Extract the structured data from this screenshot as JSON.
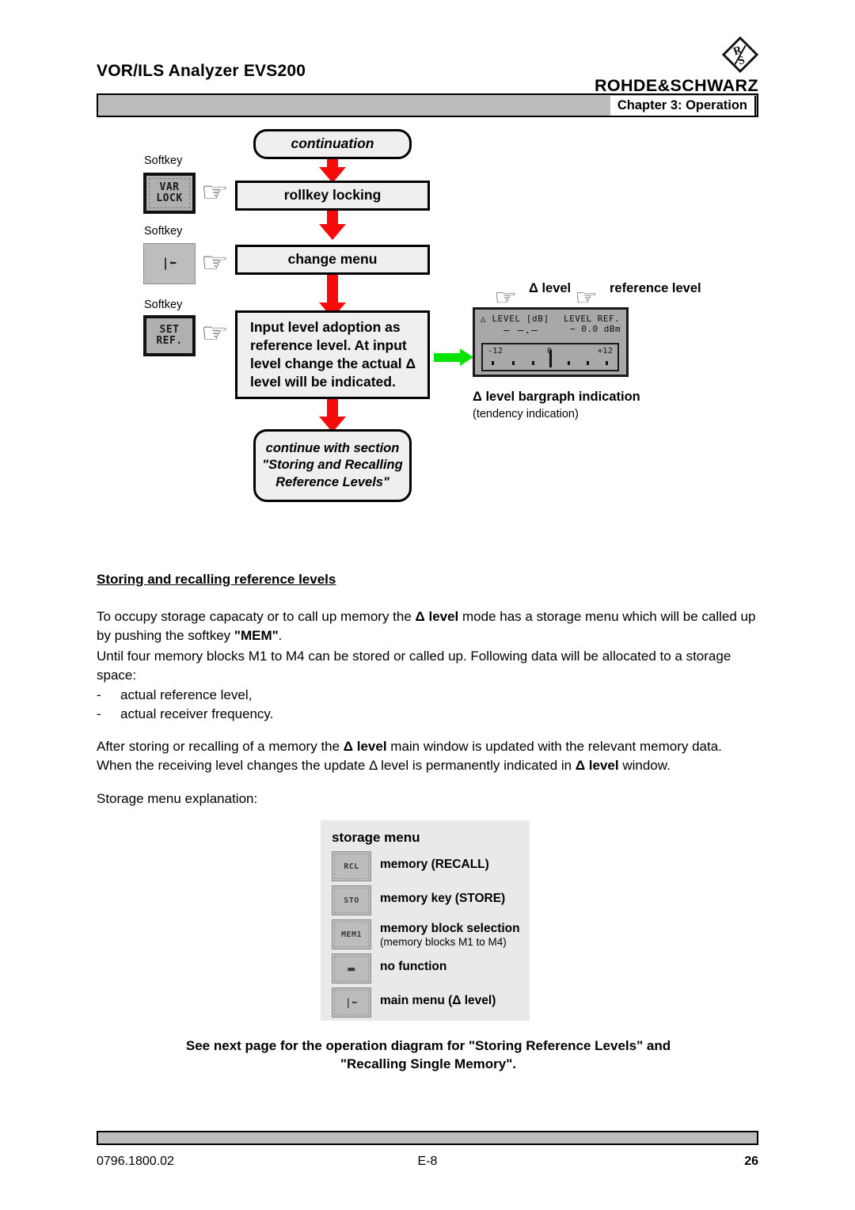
{
  "header": {
    "doc_title": "VOR/ILS Analyzer EVS200",
    "brand": "ROHDE&SCHWARZ",
    "chapter": "Chapter 3: Operation"
  },
  "flow": {
    "continuation_label": "continuation",
    "softkey_caption": "Softkey",
    "steps": [
      {
        "key_glyph": "VAR\nLOCK",
        "box_text": "rollkey locking"
      },
      {
        "key_glyph": "|⬅",
        "box_text": "change menu"
      },
      {
        "key_glyph": "SET\nREF.",
        "box_text": "Input level adoption as reference level. At input level change the actual Δ  level will be indicated."
      }
    ],
    "end_box": "continue with section \"Storing and Recalling Reference Levels\""
  },
  "lcd": {
    "callout_delta": "Δ  level",
    "callout_ref": "reference level",
    "screen": {
      "title": "△ LEVEL [dB]",
      "ref_title": "LEVEL REF.",
      "ref_value": "− 0.0 dBm",
      "value_placeholder": "— —.—",
      "bar_min": "-12",
      "bar_mid": "0",
      "bar_max": "+12"
    },
    "caption_main": "Δ  level bargraph indication",
    "caption_sub": "(tendency indication)"
  },
  "content": {
    "section_heading": "Storing and recalling reference levels",
    "para1_a": "To occupy storage capacaty or to call up memory the ",
    "para1_delta": "Δ level",
    "para1_b": " mode has a storage menu which will be called up by pushing the softkey ",
    "para1_mem": "\"MEM\"",
    "para1_c": ".",
    "para2": "Until four memory blocks M1 to M4 can be stored or called up. Following data will be allocated to a storage space:",
    "bullets": [
      {
        "dash": "-",
        "text": "actual reference level,"
      },
      {
        "dash": "-",
        "text": "actual receiver frequency."
      }
    ],
    "para3_a": "After storing or recalling of a memory the ",
    "para3_delta1": "Δ level",
    "para3_b": " main window is updated with the relevant memory data. When the receiving level changes the update Δ level is permanently indicated in ",
    "para3_delta2": "Δ level",
    "para3_c": " window.",
    "para4": "Storage menu explanation:"
  },
  "storage_menu": {
    "title": "storage menu",
    "rows": [
      {
        "key": "RCL",
        "main": "memory (RECALL)",
        "sub": ""
      },
      {
        "key": "STO",
        "main": "memory key  (STORE)",
        "sub": ""
      },
      {
        "key": "MEM1",
        "main": "memory block selection",
        "sub": "(memory blocks M1 to M4)"
      },
      {
        "key": "▬",
        "main": "no function",
        "sub": ""
      },
      {
        "key": "|⬅",
        "main": "main menu (Δ level)",
        "sub": ""
      }
    ]
  },
  "see_next": {
    "line1": "See next page for the operation diagram for \"Storing Reference Levels\" and",
    "line2": "\"Recalling Single Memory\"."
  },
  "footer": {
    "left": "0796.1800.02",
    "center": "E-8",
    "right": "26"
  },
  "colors": {
    "arrow_red": "#f60a0a",
    "arrow_green": "#05e205",
    "bar_gray": "#bcbcbc",
    "box_fill": "#efefef"
  }
}
